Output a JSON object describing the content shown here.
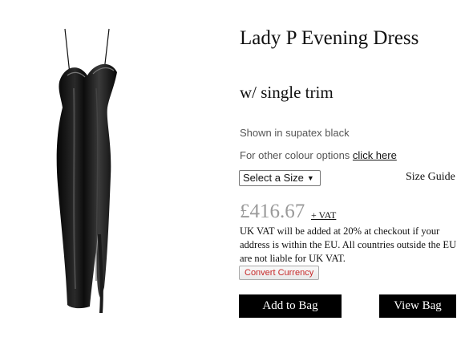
{
  "product": {
    "image_alt": "black latex evening dress",
    "title": "Lady P Evening Dress",
    "subtitle": "w/ single trim",
    "shown_in": "Shown in supatex black",
    "colour_options_prefix": "For other colour options",
    "colour_options_link": "click here"
  },
  "size": {
    "select_label": "Select a Size",
    "arrow": "▼",
    "guide_label": "Size Guide"
  },
  "pricing": {
    "price": "£416.67",
    "plus_vat": "+ VAT",
    "vat_note": "UK VAT will be added at 20% at checkout if your address is within the EU. All countries outside the EU are not liable for UK VAT.",
    "convert_label": "Convert Currency",
    "price_color": "#9a9a9a",
    "convert_color": "#c62828"
  },
  "actions": {
    "add_to_bag": "Add to Bag",
    "view_bag": "View Bag"
  }
}
